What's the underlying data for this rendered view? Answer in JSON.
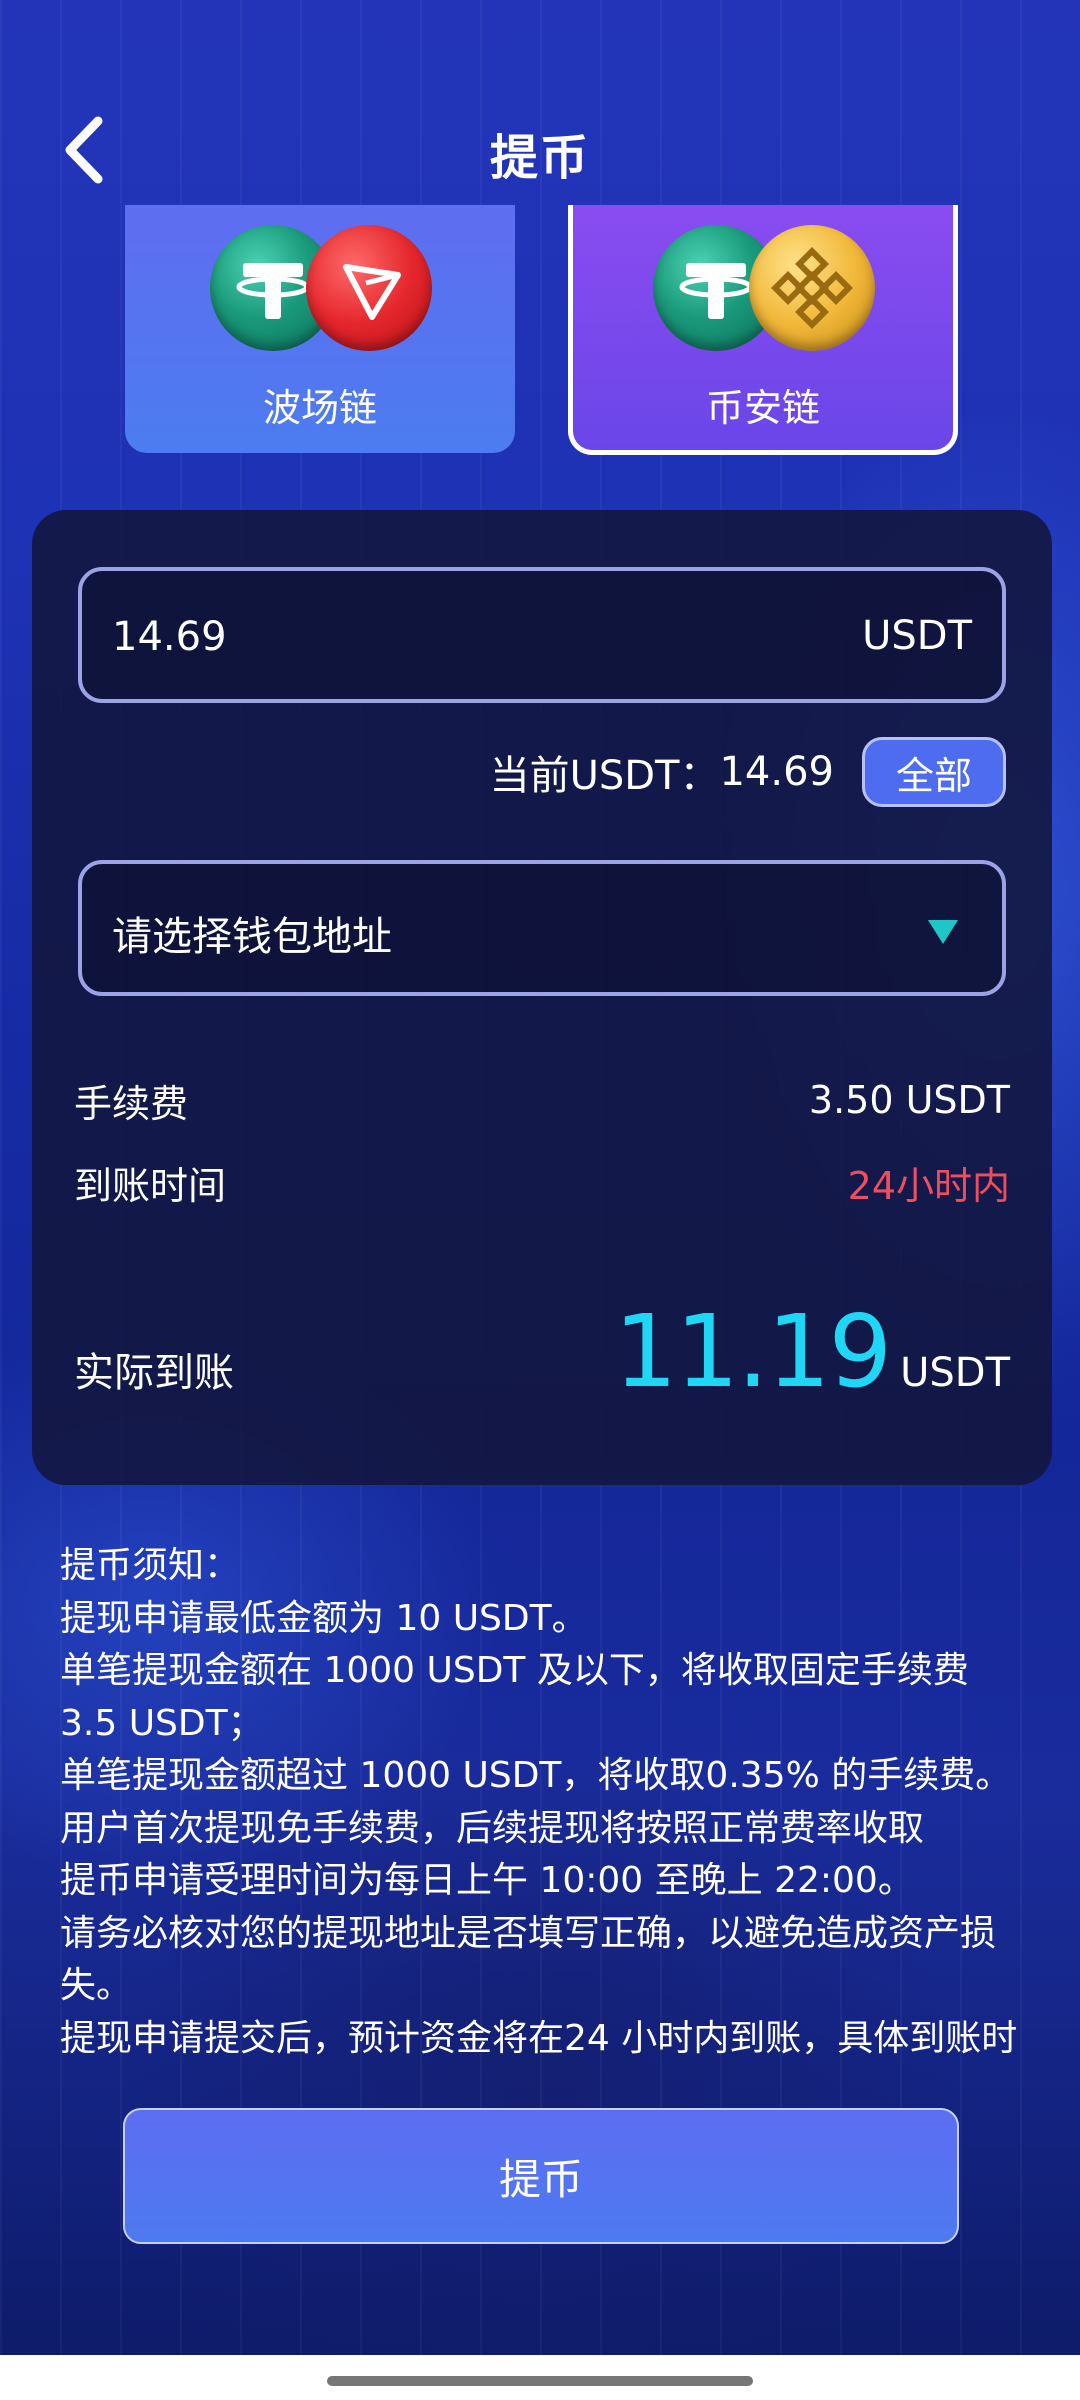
{
  "header": {
    "title": "提币"
  },
  "chains": {
    "tron_label": "波场链",
    "bsc_label": "币安链",
    "selected": "币安链"
  },
  "amount": {
    "value": "14.69",
    "unit": "USDT"
  },
  "balance": {
    "label": "当前USDT：",
    "value": "14.69",
    "all_label": "全部"
  },
  "wallet": {
    "placeholder": "请选择钱包地址"
  },
  "fee": {
    "label": "手续费",
    "value": "3.50 USDT"
  },
  "arrival_time": {
    "label": "到账时间",
    "value": "24小时内"
  },
  "actual": {
    "label": "实际到账",
    "value": "11.19",
    "unit": "USDT"
  },
  "notice": {
    "lines": [
      "提币须知：",
      "提现申请最低金额为 10 USDT。",
      "单笔提现金额在 1000 USDT 及以下，将收取固定手续费 3.5 USDT；",
      "单笔提现金额超过 1000 USDT，将收取0.35% 的手续费。",
      "用户首次提现免手续费，后续提现将按照正常费率收取",
      "提币申请受理时间为每日上午 10:00 至晚上 22:00。",
      "请务必核对您的提现地址是否填写正确，以避免造成资产损失。",
      "提现申请提交后，预计资金将在24 小时内到账，具体到账时"
    ]
  },
  "submit": {
    "label": "提币"
  },
  "colors": {
    "accent_cyan": "#1fd7f5",
    "warning_red": "#f04e5e",
    "button_blue": "#4d6cf0",
    "selected_purple": "#7a4cf0"
  },
  "icons": {
    "back": "chevron-left-icon",
    "usdt": "usdt-coin-icon",
    "tron": "tron-coin-icon",
    "bnb": "bnb-coin-icon",
    "dropdown": "caret-down-icon"
  }
}
